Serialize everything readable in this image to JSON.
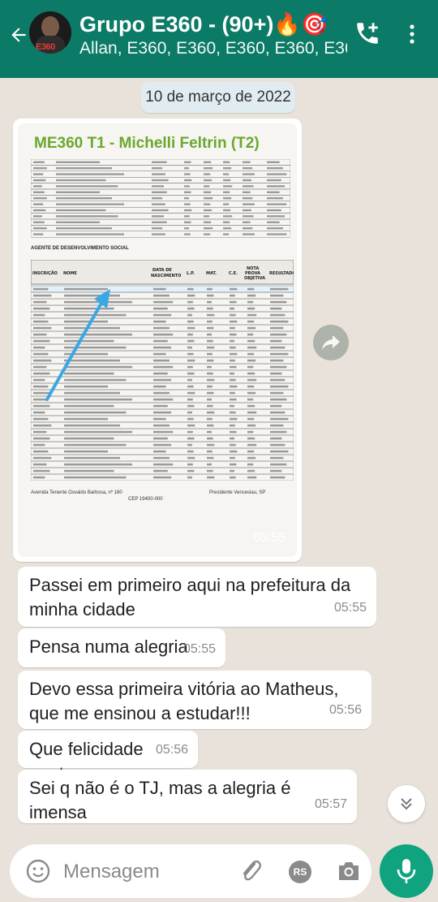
{
  "header": {
    "avatar_label": "E360",
    "title": "Grupo E360 - (90+)🔥🎯",
    "subtitle": "Allan, E360, E360, E360, E360, E360, E3..."
  },
  "date_chip": "10 de março de 2022",
  "image_message": {
    "doc_title": "ME360 T1 - Michelli Feltrin (T2)",
    "doc_subtitle": "AGENTE DE DESENVOLVIMENTO SOCIAL",
    "doc_footer_left": "Avenida Tenente Osvaldo Barbosa, nº 180",
    "doc_footer_cep": "CEP 19400-000",
    "doc_footer_city": "Presidente Venceslau, SP",
    "time": "05:55"
  },
  "messages": [
    {
      "text": "Passei em primeiro aqui na prefeitura da minha cidade",
      "time": "05:55"
    },
    {
      "text": "Pensa numa alegria",
      "time": "05:55"
    },
    {
      "text": "Devo essa primeira vitória ao Matheus, que me ensinou a estudar!!!",
      "time": "05:56"
    },
    {
      "text": "Que felicidade gente",
      "time": "05:56"
    },
    {
      "text": "Sei q não é o TJ, mas a alegria é imensa",
      "time": "05:57"
    }
  ],
  "input": {
    "placeholder": "Mensagem",
    "rs_label": "RS"
  },
  "colors": {
    "header": "#0b7a66",
    "chat_bg": "#e9e2da",
    "mic": "#10a37f",
    "doc_title": "#6aa82e"
  }
}
